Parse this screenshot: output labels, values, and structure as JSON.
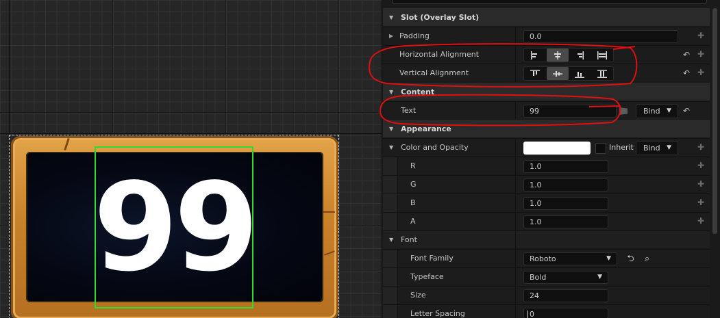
{
  "preview": {
    "number_text": "99"
  },
  "details": {
    "slot_category": "Slot (Overlay Slot)",
    "padding": {
      "label": "Padding",
      "value": "0.0"
    },
    "horizontal_alignment": {
      "label": "Horizontal Alignment",
      "selected_index": 1
    },
    "vertical_alignment": {
      "label": "Vertical Alignment",
      "selected_index": 1
    },
    "content_category": "Content",
    "text": {
      "label": "Text",
      "value": "99",
      "bind_label": "Bind"
    },
    "appearance_category": "Appearance",
    "color_and_opacity": {
      "label": "Color and Opacity",
      "inherit_label": "Inherit",
      "bind_label": "Bind",
      "swatch_color": "#ffffff"
    },
    "r": {
      "label": "R",
      "value": "1.0"
    },
    "g": {
      "label": "G",
      "value": "1.0"
    },
    "b": {
      "label": "B",
      "value": "1.0"
    },
    "a": {
      "label": "A",
      "value": "1.0"
    },
    "font_category": "Font",
    "font_family": {
      "label": "Font Family",
      "value": "Roboto"
    },
    "typeface": {
      "label": "Typeface",
      "value": "Bold"
    },
    "size": {
      "label": "Size",
      "value": "24"
    },
    "letter_spacing": {
      "label": "Letter Spacing",
      "value": "0"
    }
  },
  "icons": {
    "expand": "triangle-right-icon",
    "collapse": "triangle-down-icon",
    "reset": "reset-arrow-icon",
    "keyframe": "add-key-icon",
    "dropdown": "chevron-down-icon",
    "browse": "browse-arrow-icon",
    "find": "find-in-browser-icon"
  },
  "colors": {
    "selection_outline": "#2fdc2f",
    "annotation": "#e01010",
    "panel_bg": "#1a1a1a"
  }
}
